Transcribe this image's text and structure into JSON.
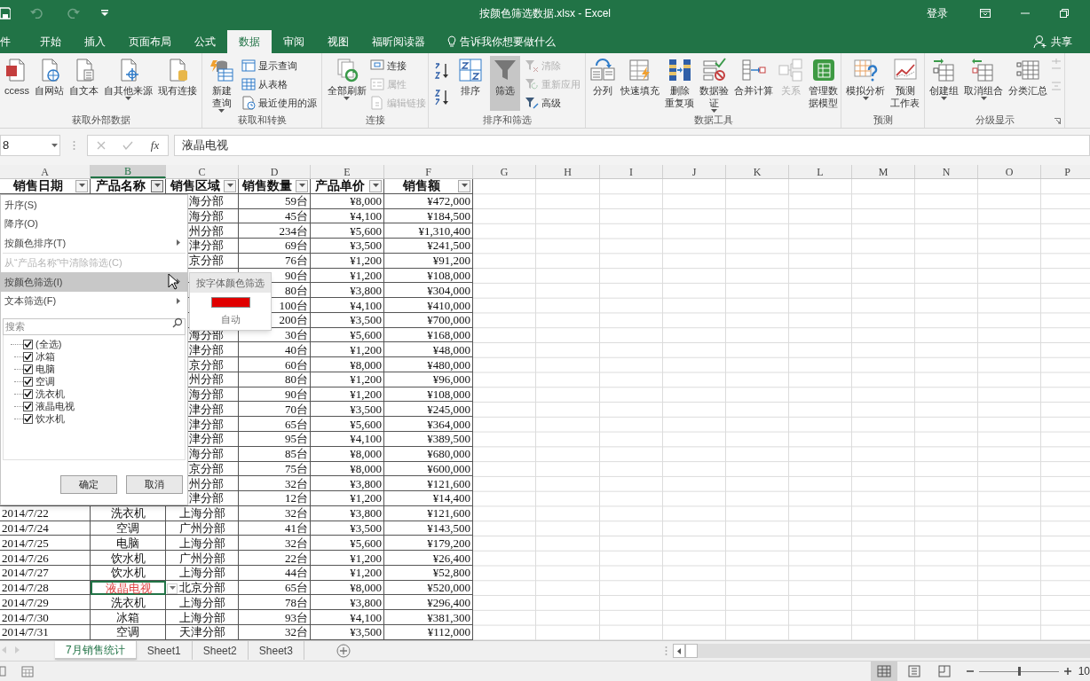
{
  "title_bar": {
    "title": "按颜色筛选数据.xlsx - Excel",
    "sign_in": "登录"
  },
  "ribbon_tabs": [
    {
      "label": "件",
      "selected": false
    },
    {
      "label": "开始",
      "selected": false
    },
    {
      "label": "插入",
      "selected": false
    },
    {
      "label": "页面布局",
      "selected": false
    },
    {
      "label": "公式",
      "selected": false
    },
    {
      "label": "数据",
      "selected": true
    },
    {
      "label": "审阅",
      "selected": false
    },
    {
      "label": "视图",
      "selected": false
    },
    {
      "label": "福昕阅读器",
      "selected": false
    }
  ],
  "tell_me": "告诉我你想要做什么",
  "share": "共享",
  "ribbon_groups": [
    {
      "label": "获取外部数据",
      "launcher": false,
      "items": [
        {
          "kind": "big",
          "lines": [
            "ccess"
          ],
          "dropdown": false,
          "disabled": false,
          "pressed": false
        },
        {
          "kind": "big",
          "lines": [
            "自网站"
          ],
          "dropdown": false,
          "disabled": false,
          "pressed": false
        },
        {
          "kind": "big",
          "lines": [
            "自文本"
          ],
          "dropdown": false,
          "disabled": false,
          "pressed": false
        },
        {
          "kind": "big",
          "lines": [
            "自其他来源"
          ],
          "dropdown": true,
          "disabled": false,
          "pressed": false
        },
        {
          "kind": "big",
          "lines": [
            "现有连接"
          ],
          "dropdown": false,
          "disabled": false,
          "pressed": false
        }
      ]
    },
    {
      "label": "获取和转换",
      "launcher": false,
      "items": [
        {
          "kind": "big",
          "lines": [
            "新建",
            "查询"
          ],
          "dropdown": true,
          "disabled": false,
          "pressed": false
        },
        {
          "kind": "stack",
          "buttons": [
            {
              "label": "显示查询",
              "disabled": false
            },
            {
              "label": "从表格",
              "disabled": false
            },
            {
              "label": "最近使用的源",
              "disabled": false
            }
          ]
        }
      ]
    },
    {
      "label": "连接",
      "launcher": false,
      "items": [
        {
          "kind": "big",
          "lines": [
            "全部刷新"
          ],
          "dropdown": true,
          "disabled": false,
          "pressed": false
        },
        {
          "kind": "stack",
          "buttons": [
            {
              "label": "连接",
              "disabled": false
            },
            {
              "label": "属性",
              "disabled": true
            },
            {
              "label": "编辑链接",
              "disabled": true
            }
          ]
        }
      ]
    },
    {
      "label": "排序和筛选",
      "launcher": false,
      "items": [
        {
          "kind": "sort_buttons"
        },
        {
          "kind": "big",
          "lines": [
            "排序"
          ],
          "dropdown": false,
          "disabled": false,
          "pressed": false
        },
        {
          "kind": "big",
          "lines": [
            "筛选"
          ],
          "dropdown": false,
          "disabled": false,
          "pressed": true
        },
        {
          "kind": "stack",
          "buttons": [
            {
              "label": "清除",
              "disabled": true
            },
            {
              "label": "重新应用",
              "disabled": true
            },
            {
              "label": "高级",
              "disabled": false
            }
          ]
        }
      ]
    },
    {
      "label": "数据工具",
      "launcher": false,
      "items": [
        {
          "kind": "big",
          "lines": [
            "分列"
          ],
          "dropdown": false,
          "disabled": false,
          "pressed": false
        },
        {
          "kind": "big",
          "lines": [
            "快速填充"
          ],
          "dropdown": false,
          "disabled": false,
          "pressed": false
        },
        {
          "kind": "big",
          "lines": [
            "删除",
            "重复项"
          ],
          "dropdown": false,
          "disabled": false,
          "pressed": false
        },
        {
          "kind": "big",
          "lines": [
            "数据验",
            "证"
          ],
          "dropdown": true,
          "disabled": false,
          "pressed": false
        },
        {
          "kind": "big",
          "lines": [
            "合并计算"
          ],
          "dropdown": false,
          "disabled": false,
          "pressed": false
        },
        {
          "kind": "big",
          "lines": [
            "关系"
          ],
          "dropdown": false,
          "disabled": true,
          "pressed": false
        },
        {
          "kind": "big",
          "lines": [
            "管理数",
            "据模型"
          ],
          "dropdown": false,
          "disabled": false,
          "pressed": false
        }
      ]
    },
    {
      "label": "预测",
      "launcher": false,
      "items": [
        {
          "kind": "big",
          "lines": [
            "模拟分析"
          ],
          "dropdown": true,
          "disabled": false,
          "pressed": false
        },
        {
          "kind": "big",
          "lines": [
            "预测",
            "工作表"
          ],
          "dropdown": false,
          "disabled": false,
          "pressed": false
        }
      ]
    },
    {
      "label": "分级显示",
      "launcher": true,
      "items": [
        {
          "kind": "big",
          "lines": [
            "创建组"
          ],
          "dropdown": true,
          "disabled": false,
          "pressed": false
        },
        {
          "kind": "big",
          "lines": [
            "取消组合"
          ],
          "dropdown": true,
          "disabled": false,
          "pressed": false
        },
        {
          "kind": "big",
          "lines": [
            "分类汇总"
          ],
          "dropdown": false,
          "disabled": false,
          "pressed": false
        },
        {
          "kind": "outline_icons"
        }
      ]
    }
  ],
  "formula_bar": {
    "name_box": "8",
    "insert_function": "fx",
    "content": "液晶电视"
  },
  "columns": [
    {
      "label": "A",
      "selected": false
    },
    {
      "label": "B",
      "selected": true
    },
    {
      "label": "C",
      "selected": false
    },
    {
      "label": "D",
      "selected": false
    },
    {
      "label": "E",
      "selected": false
    },
    {
      "label": "F",
      "selected": false
    },
    {
      "label": "G",
      "selected": false
    },
    {
      "label": "H",
      "selected": false
    },
    {
      "label": "I",
      "selected": false
    },
    {
      "label": "J",
      "selected": false
    },
    {
      "label": "K",
      "selected": false
    },
    {
      "label": "L",
      "selected": false
    },
    {
      "label": "M",
      "selected": false
    },
    {
      "label": "N",
      "selected": false
    },
    {
      "label": "O",
      "selected": false
    },
    {
      "label": "P",
      "selected": false
    }
  ],
  "table": {
    "headers": [
      {
        "label": "销售日期",
        "open": false
      },
      {
        "label": "产品名称",
        "open": true
      },
      {
        "label": "销售区域",
        "open": false
      },
      {
        "label": "销售数量",
        "open": false
      },
      {
        "label": "产品单价",
        "open": false
      },
      {
        "label": "销售额",
        "open": false
      }
    ],
    "rows": [
      {
        "region": "海分部",
        "qty": "59台",
        "price": "¥8,000",
        "amount": "¥472,000",
        "under_menu": true,
        "selected": false
      },
      {
        "region": "海分部",
        "qty": "45台",
        "price": "¥4,100",
        "amount": "¥184,500",
        "under_menu": true,
        "selected": false
      },
      {
        "region": "州分部",
        "qty": "234台",
        "price": "¥5,600",
        "amount": "¥1,310,400",
        "under_menu": true,
        "selected": false
      },
      {
        "region": "津分部",
        "qty": "69台",
        "price": "¥3,500",
        "amount": "¥241,500",
        "under_menu": true,
        "selected": false
      },
      {
        "region": "京分部",
        "qty": "76台",
        "price": "¥1,200",
        "amount": "¥91,200",
        "under_menu": true,
        "selected": false
      },
      {
        "qty": "90台",
        "price": "¥1,200",
        "amount": "¥108,000",
        "under_menu": true,
        "selected": false
      },
      {
        "qty": "80台",
        "price": "¥3,800",
        "amount": "¥304,000",
        "under_menu": true,
        "selected": false
      },
      {
        "qty": "100台",
        "price": "¥4,100",
        "amount": "¥410,000",
        "under_menu": true,
        "selected": false
      },
      {
        "qty": "200台",
        "price": "¥3,500",
        "amount": "¥700,000",
        "under_menu": true,
        "selected": false
      },
      {
        "region": "海分部",
        "qty": "30台",
        "price": "¥5,600",
        "amount": "¥168,000",
        "under_menu": true,
        "selected": false
      },
      {
        "region": "津分部",
        "qty": "40台",
        "price": "¥1,200",
        "amount": "¥48,000",
        "under_menu": true,
        "selected": false
      },
      {
        "region": "京分部",
        "qty": "60台",
        "price": "¥8,000",
        "amount": "¥480,000",
        "under_menu": true,
        "selected": false
      },
      {
        "region": "州分部",
        "qty": "80台",
        "price": "¥1,200",
        "amount": "¥96,000",
        "under_menu": true,
        "selected": false
      },
      {
        "region": "海分部",
        "qty": "90台",
        "price": "¥1,200",
        "amount": "¥108,000",
        "under_menu": true,
        "selected": false
      },
      {
        "region": "津分部",
        "qty": "70台",
        "price": "¥3,500",
        "amount": "¥245,000",
        "under_menu": true,
        "selected": false
      },
      {
        "region": "津分部",
        "qty": "65台",
        "price": "¥5,600",
        "amount": "¥364,000",
        "under_menu": true,
        "selected": false
      },
      {
        "region": "津分部",
        "qty": "95台",
        "price": "¥4,100",
        "amount": "¥389,500",
        "under_menu": true,
        "selected": false
      },
      {
        "region": "海分部",
        "qty": "85台",
        "price": "¥8,000",
        "amount": "¥680,000",
        "under_menu": true,
        "selected": false
      },
      {
        "region": "京分部",
        "qty": "75台",
        "price": "¥8,000",
        "amount": "¥600,000",
        "under_menu": true,
        "selected": false
      },
      {
        "region": "州分部",
        "qty": "32台",
        "price": "¥3,800",
        "amount": "¥121,600",
        "under_menu": true,
        "selected": false
      },
      {
        "region": "津分部",
        "qty": "12台",
        "price": "¥1,200",
        "amount": "¥14,400",
        "under_menu": true,
        "selected": false
      },
      {
        "date": "2014/7/22",
        "product": "洗衣机",
        "region": "上海分部",
        "qty": "32台",
        "price": "¥3,800",
        "amount": "¥121,600",
        "under_menu": false,
        "selected": false
      },
      {
        "date": "2014/7/24",
        "product": "空调",
        "region": "广州分部",
        "qty": "41台",
        "price": "¥3,500",
        "amount": "¥143,500",
        "under_menu": false,
        "selected": false
      },
      {
        "date": "2014/7/25",
        "product": "电脑",
        "region": "上海分部",
        "qty": "32台",
        "price": "¥5,600",
        "amount": "¥179,200",
        "under_menu": false,
        "selected": false
      },
      {
        "date": "2014/7/26",
        "product": "饮水机",
        "region": "广州分部",
        "qty": "22台",
        "price": "¥1,200",
        "amount": "¥26,400",
        "under_menu": false,
        "selected": false
      },
      {
        "date": "2014/7/27",
        "product": "饮水机",
        "region": "上海分部",
        "qty": "44台",
        "price": "¥1,200",
        "amount": "¥52,800",
        "under_menu": false,
        "selected": false
      },
      {
        "date": "2014/7/28",
        "product": "液晶电视",
        "color": "#e04040",
        "region": "北京分部",
        "qty": "65台",
        "price": "¥8,000",
        "amount": "¥520,000",
        "under_menu": false,
        "selected": true
      },
      {
        "date": "2014/7/29",
        "product": "洗衣机",
        "region": "上海分部",
        "qty": "78台",
        "price": "¥3,800",
        "amount": "¥296,400",
        "under_menu": false,
        "selected": false
      },
      {
        "date": "2014/7/30",
        "product": "冰箱",
        "region": "上海分部",
        "qty": "93台",
        "price": "¥4,100",
        "amount": "¥381,300",
        "under_menu": false,
        "selected": false
      },
      {
        "date": "2014/7/31",
        "product": "空调",
        "region": "天津分部",
        "qty": "32台",
        "price": "¥3,500",
        "amount": "¥112,000",
        "under_menu": false,
        "selected": false
      }
    ]
  },
  "filter_menu": {
    "items": [
      {
        "label": "升序(S)",
        "disabled": false,
        "selected": false,
        "submenu": false,
        "divider_above": false
      },
      {
        "label": "降序(O)",
        "disabled": false,
        "selected": false,
        "submenu": false,
        "divider_above": false
      },
      {
        "label": "按颜色排序(T)",
        "disabled": false,
        "selected": false,
        "submenu": true,
        "divider_above": false
      },
      {
        "label": "从“产品名称”中清除筛选(C)",
        "disabled": true,
        "selected": false,
        "submenu": false,
        "divider_above": true
      },
      {
        "label": "按颜色筛选(I)",
        "disabled": false,
        "selected": true,
        "submenu": true,
        "divider_above": false
      },
      {
        "label": "文本筛选(F)",
        "disabled": false,
        "selected": false,
        "submenu": true,
        "divider_above": false
      }
    ],
    "search_placeholder": "搜索",
    "values": [
      {
        "label": "(全选)",
        "checked": true,
        "children": [
          {
            "label": "冰箱",
            "checked": true
          },
          {
            "label": "电脑",
            "checked": true
          },
          {
            "label": "空调",
            "checked": true
          },
          {
            "label": "洗衣机",
            "checked": true
          },
          {
            "label": "液晶电视",
            "checked": true
          },
          {
            "label": "饮水机",
            "checked": true
          }
        ]
      }
    ],
    "ok": "确定",
    "cancel": "取消"
  },
  "color_submenu": {
    "heading": "按字体颜色筛选",
    "colors": [
      {
        "color": "#e00000"
      }
    ],
    "auto": "自动"
  },
  "sheet_tabs": [
    {
      "label": "7月销售统计",
      "selected": true
    },
    {
      "label": "Sheet1",
      "selected": false
    },
    {
      "label": "Sheet2",
      "selected": false
    },
    {
      "label": "Sheet3",
      "selected": false
    }
  ],
  "status_bar": {
    "views": [
      {
        "selected": true
      },
      {
        "selected": false
      },
      {
        "selected": false
      }
    ],
    "level": 0.49,
    "zoom": "10"
  }
}
